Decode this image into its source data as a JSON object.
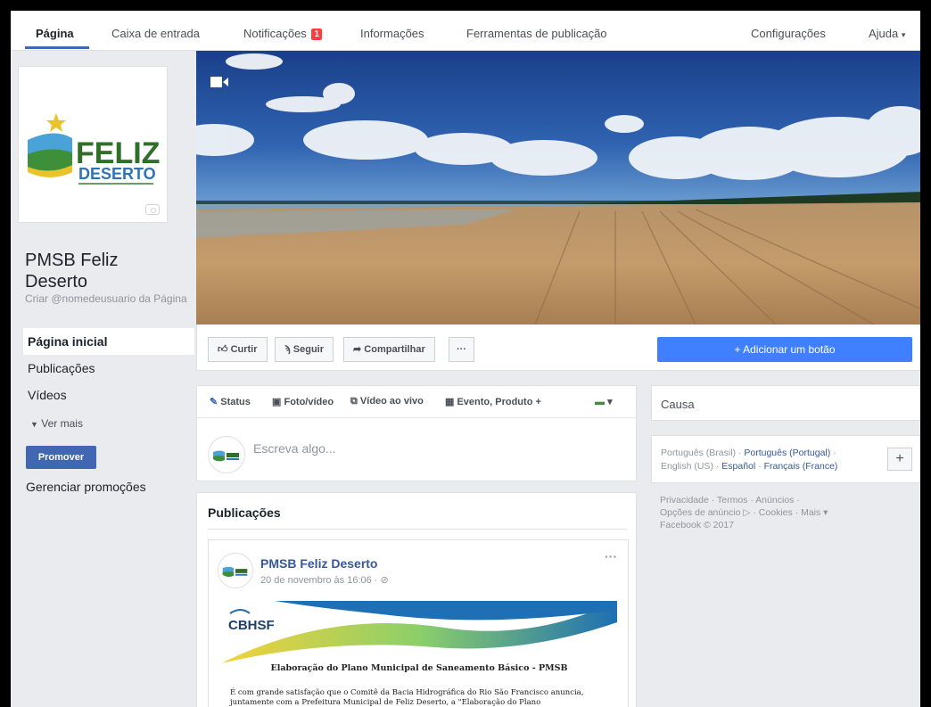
{
  "topnav": {
    "items": [
      "Página",
      "Caixa de entrada",
      "Notificações",
      "Informações",
      "Ferramentas de publicação",
      "Configurações",
      "Ajuda"
    ],
    "notifications_badge": "1",
    "dropdown_glyph": "▾"
  },
  "logo": {
    "main": "FELIZ",
    "sub": "DESERTO"
  },
  "page": {
    "name": "PMSB Feliz Deserto",
    "username_link": "Criar @nomedeusuario da Página"
  },
  "leftnav": {
    "items": [
      "Página inicial",
      "Publicações",
      "Vídeos"
    ],
    "ver_mais": "Ver mais",
    "promote_button": "Promover",
    "manage_promotions": "Gerenciar promoções"
  },
  "actions": {
    "like": "Curtir",
    "follow": "Seguir",
    "share": "Compartilhar",
    "more": "···",
    "add_button": "+ Adicionar um botão"
  },
  "composer": {
    "tabs": [
      "Status",
      "Foto/vídeo",
      "Vídeo ao vivo",
      "Evento, Produto +"
    ],
    "placeholder": "Escreva algo..."
  },
  "posts": {
    "title": "Publicações",
    "author": "PMSB Feliz Deserto",
    "date": "20 de novembro às 16:06 · ",
    "more": "···",
    "doc_logo": "CBHSF",
    "doc_title": "Elaboração do Plano Municipal de Saneamento Básico - PMSB",
    "doc_text_1": "É com grande satisfação que o Comitê da Bacia Hidrográfica do Rio São Francisco anuncia,",
    "doc_text_2": "juntamente com a Prefeitura Municipal de Feliz Deserto, a \"Elaboração do Plano"
  },
  "sidebar": {
    "causa": "Causa",
    "languages": [
      {
        "label": "Português (Brasil)",
        "link": false
      },
      {
        "label": "Português (Portugal)",
        "link": true
      },
      {
        "label": "English (US)",
        "link": false
      },
      {
        "label": "Español",
        "link": true
      },
      {
        "label": "Français (France)",
        "link": true
      }
    ],
    "add_language": "+",
    "footer_line1": "Privacidade · Termos · Anúncios ·",
    "footer_line2": "Opções de anúncio ▷ · Cookies · Mais ▾",
    "footer_line3": "Facebook © 2017"
  },
  "colors": {
    "brand_blue": "#4267b2",
    "button_blue": "#4080ff",
    "link_blue": "#365899",
    "notification_red": "#fa3e3e",
    "page_bg": "#e9ebee"
  }
}
